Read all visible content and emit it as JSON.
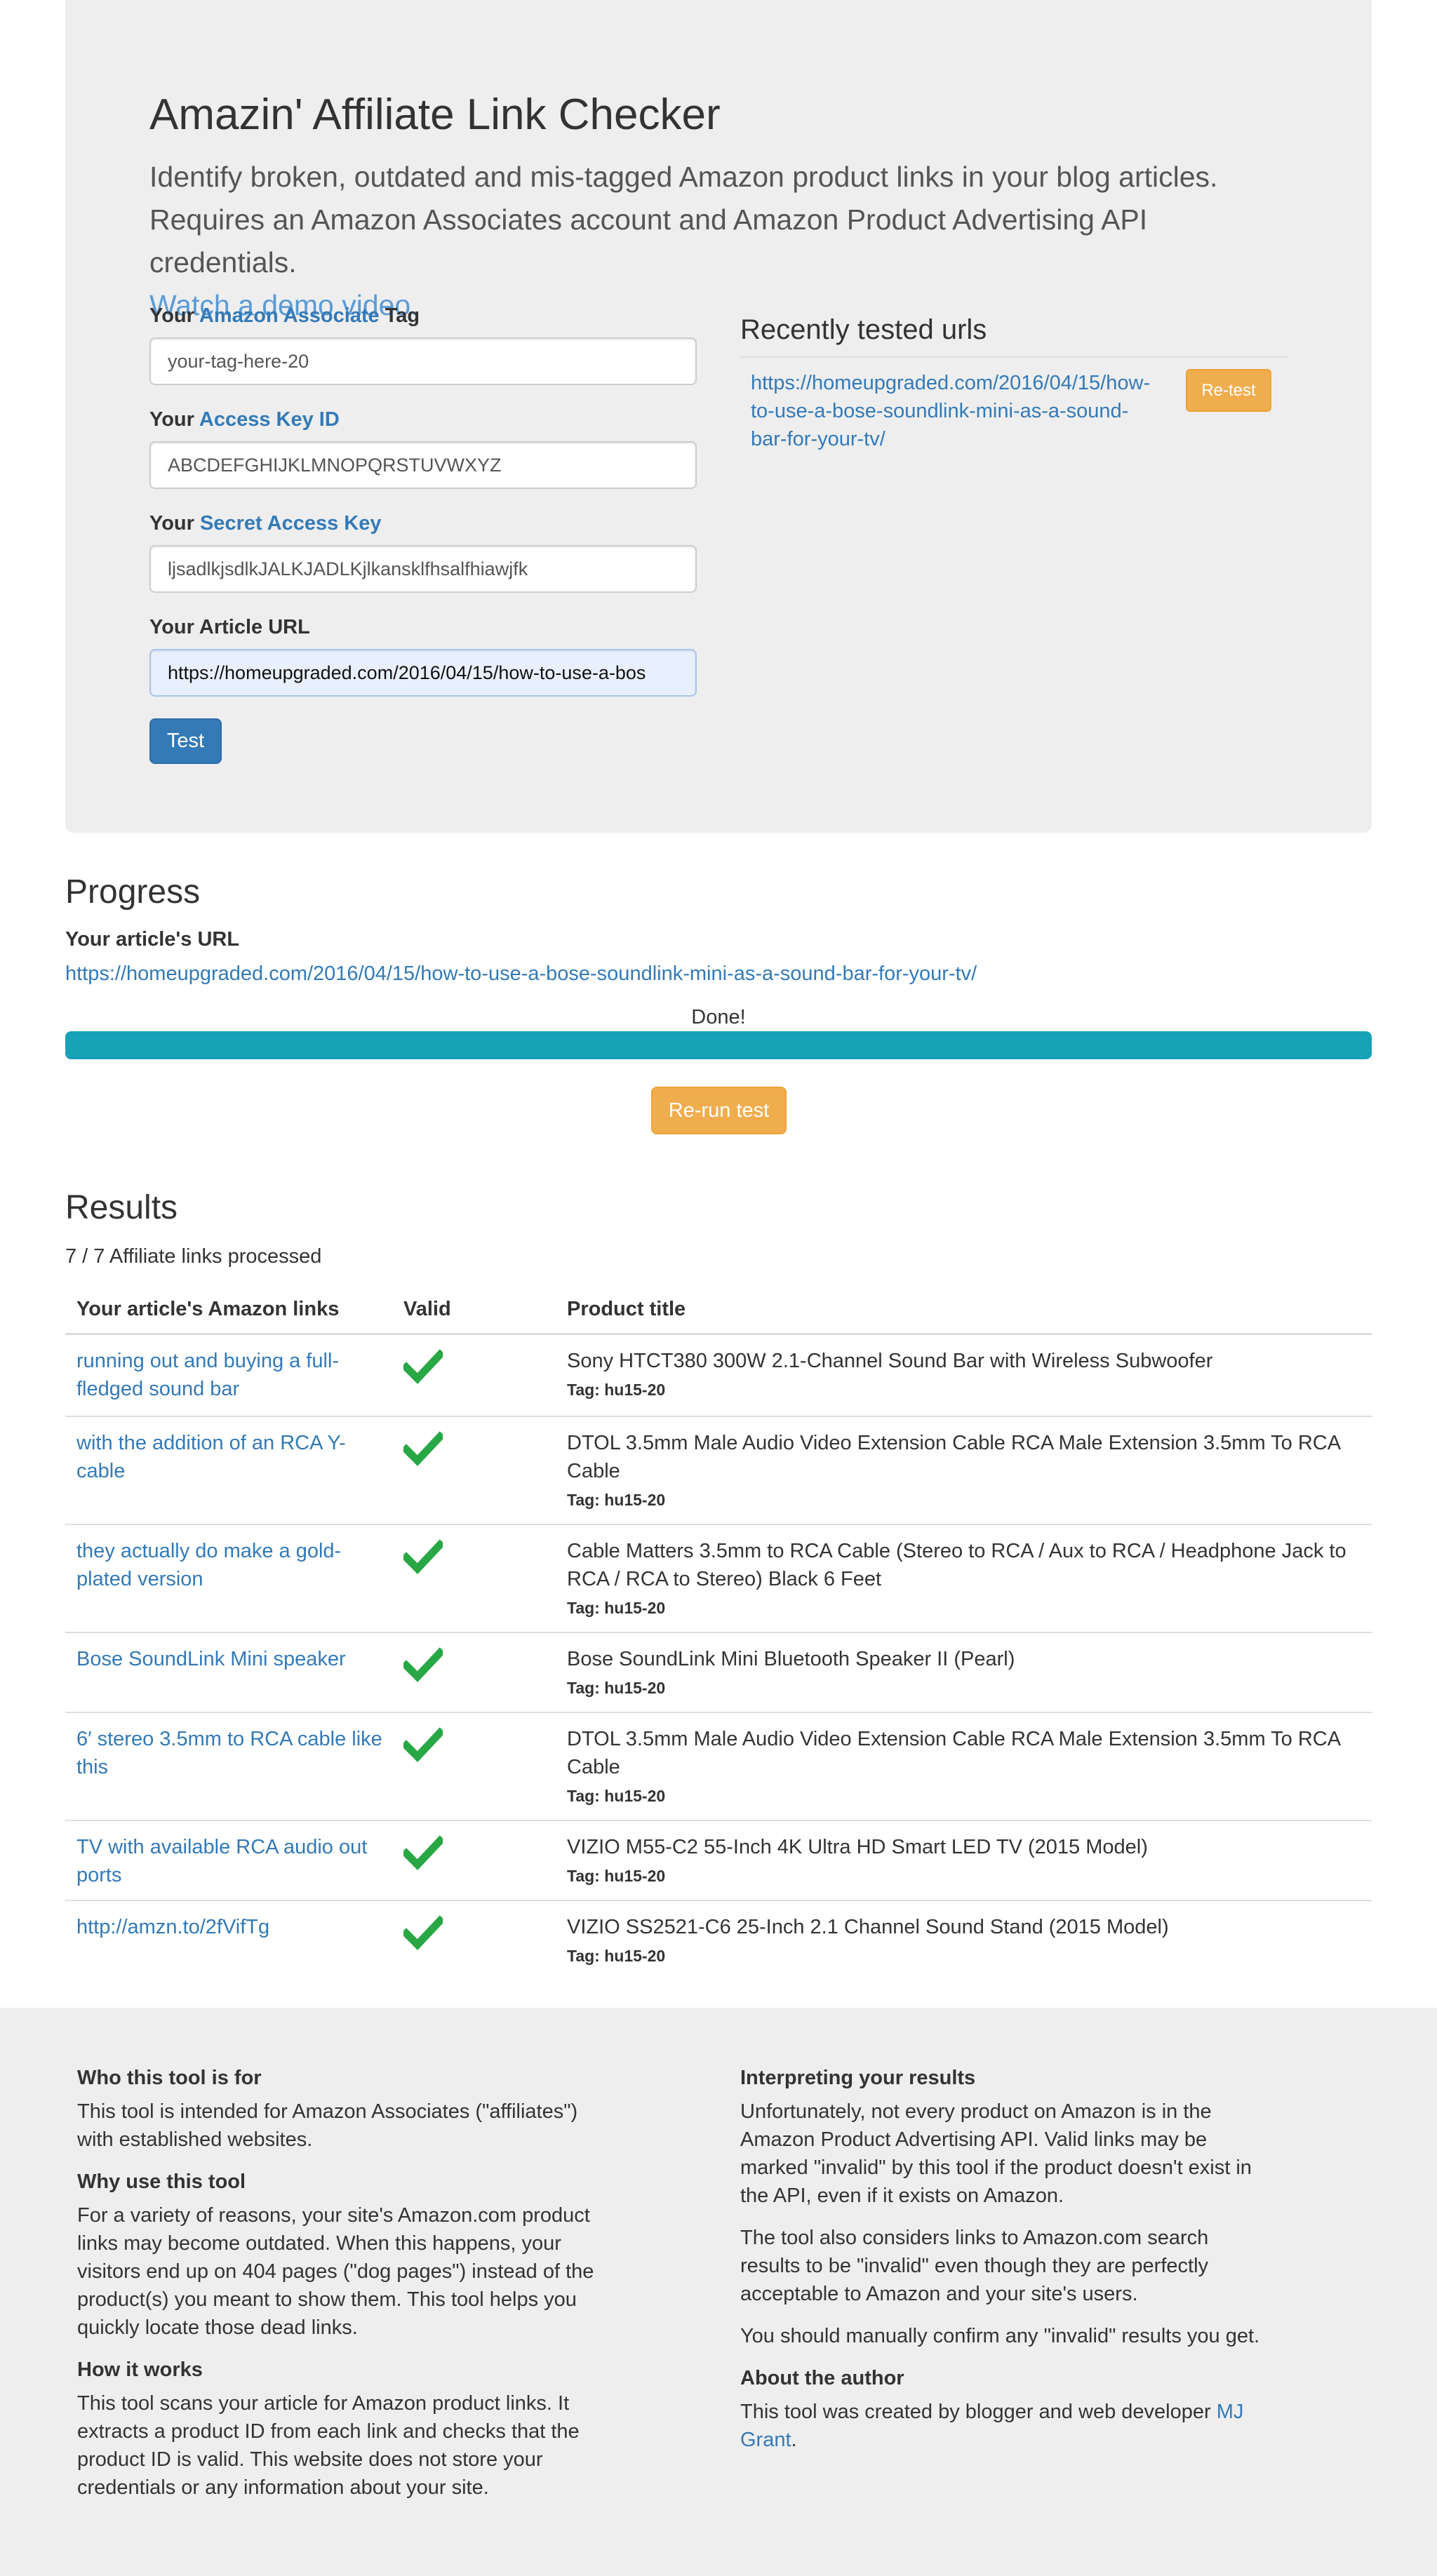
{
  "jumbotron": {
    "title": "Amazin' Affiliate Link Checker",
    "lead_line1": "Identify broken, outdated and mis-tagged Amazon product links in your blog articles.",
    "lead_line2": "Requires an Amazon Associates account and Amazon Product Advertising API credentials.",
    "demo_link": "Watch a demo video."
  },
  "form": {
    "tag_label_pre": "Your",
    "tag_label_link": "Amazon Associate",
    "tag_label_post": "Tag",
    "tag_value": "your-tag-here-20",
    "key_label_pre": "Your",
    "key_label_link": "Access Key ID",
    "key_value": "ABCDEFGHIJKLMNOPQRSTUVWXYZ",
    "secret_label_pre": "Your",
    "secret_label_link": "Secret Access Key",
    "secret_value": "ljsadlkjsdlkJALKJADLKjlkansklfhsalfhiawjfk",
    "url_label": "Your Article URL",
    "url_value": "https://homeupgraded.com/2016/04/15/how-to-use-a-bos",
    "test_button": "Test"
  },
  "recent": {
    "title": "Recently tested urls",
    "url_line1": "https://homeupgraded.com/2016/04/15/how-",
    "url_line2": "to-use-a-bose-soundlink-mini-as-a-sound-",
    "url_line3": "bar-for-your-tv/",
    "retest_button": "Re-test"
  },
  "progress": {
    "heading": "Progress",
    "url_label": "Your article's URL",
    "url": "https://homeupgraded.com/2016/04/15/how-to-use-a-bose-soundlink-mini-as-a-sound-bar-for-your-tv/",
    "status": "Done!",
    "percent": 100,
    "bar_color": "#17a2b8",
    "rerun_button": "Re-run test"
  },
  "results": {
    "heading": "Results",
    "processed": "7 / 7 Affiliate links processed",
    "columns": [
      "Your article's Amazon links",
      "Valid",
      "Product title"
    ],
    "valid_color": "#28a745",
    "rows": [
      {
        "link": "running out and buying a full-fledged sound bar",
        "valid": "check-icon",
        "title": "Sony HTCT380 300W 2.1-Channel Sound Bar with Wireless Subwoofer",
        "tag": "Tag: hu15-20"
      },
      {
        "link": "with the addition of an RCA Y-cable",
        "valid": "check-icon",
        "title": "DTOL 3.5mm Male Audio Video Extension Cable RCA Male Extension 3.5mm To RCA Cable",
        "tag": "Tag: hu15-20"
      },
      {
        "link": "they actually do make a gold-plated version",
        "valid": "check-icon",
        "title": "Cable Matters 3.5mm to RCA Cable (Stereo to RCA / Aux to RCA / Headphone Jack to RCA / RCA to Stereo) Black 6 Feet",
        "tag": "Tag: hu15-20"
      },
      {
        "link": "Bose SoundLink Mini speaker",
        "valid": "check-icon",
        "title": "Bose SoundLink Mini Bluetooth Speaker II (Pearl)",
        "tag": "Tag: hu15-20"
      },
      {
        "link": "6′ stereo 3.5mm to RCA cable like this",
        "valid": "check-icon",
        "title": "DTOL 3.5mm Male Audio Video Extension Cable RCA Male Extension 3.5mm To RCA Cable",
        "tag": "Tag: hu15-20"
      },
      {
        "link": "TV with available RCA audio out ports",
        "valid": "check-icon",
        "title": "VIZIO M55-C2 55-Inch 4K Ultra HD Smart LED TV (2015 Model)",
        "tag": "Tag: hu15-20"
      },
      {
        "link": "http://amzn.to/2fVifTg",
        "valid": "check-icon",
        "title": "VIZIO SS2521-C6 25-Inch 2.1 Channel Sound Stand (2015 Model)",
        "tag": "Tag: hu15-20"
      }
    ]
  },
  "footer": {
    "who_heading": "Who this tool is for",
    "who_text": "This tool is intended for Amazon Associates (\"affiliates\") with established websites.",
    "why_heading": "Why use this tool",
    "why_text": "For a variety of reasons, your site's Amazon.com product links may become outdated. When this happens, your visitors end up on 404 pages (\"dog pages\") instead of the product(s) you meant to show them. This tool helps you quickly locate those dead links.",
    "how_heading": "How it works",
    "how_text": "This tool scans your article for Amazon product links. It extracts a product ID from each link and checks that the product ID is valid. This website does not store your credentials or any information about your site.",
    "interp_heading": "Interpreting your results",
    "interp_text1": "Unfortunately, not every product on Amazon is in the Amazon Product Advertising API. Valid links may be marked \"invalid\" by this tool if the product doesn't exist in the API, even if it exists on Amazon.",
    "interp_text2": "The tool also considers links to Amazon.com search results to be \"invalid\" even though they are perfectly acceptable to Amazon and your site's users.",
    "interp_text3": "You should manually confirm any \"invalid\" results you get.",
    "author_heading": "About the author",
    "author_text": "This tool was created by blogger and web developer",
    "author_link": "MJ Grant",
    "author_end": "."
  }
}
